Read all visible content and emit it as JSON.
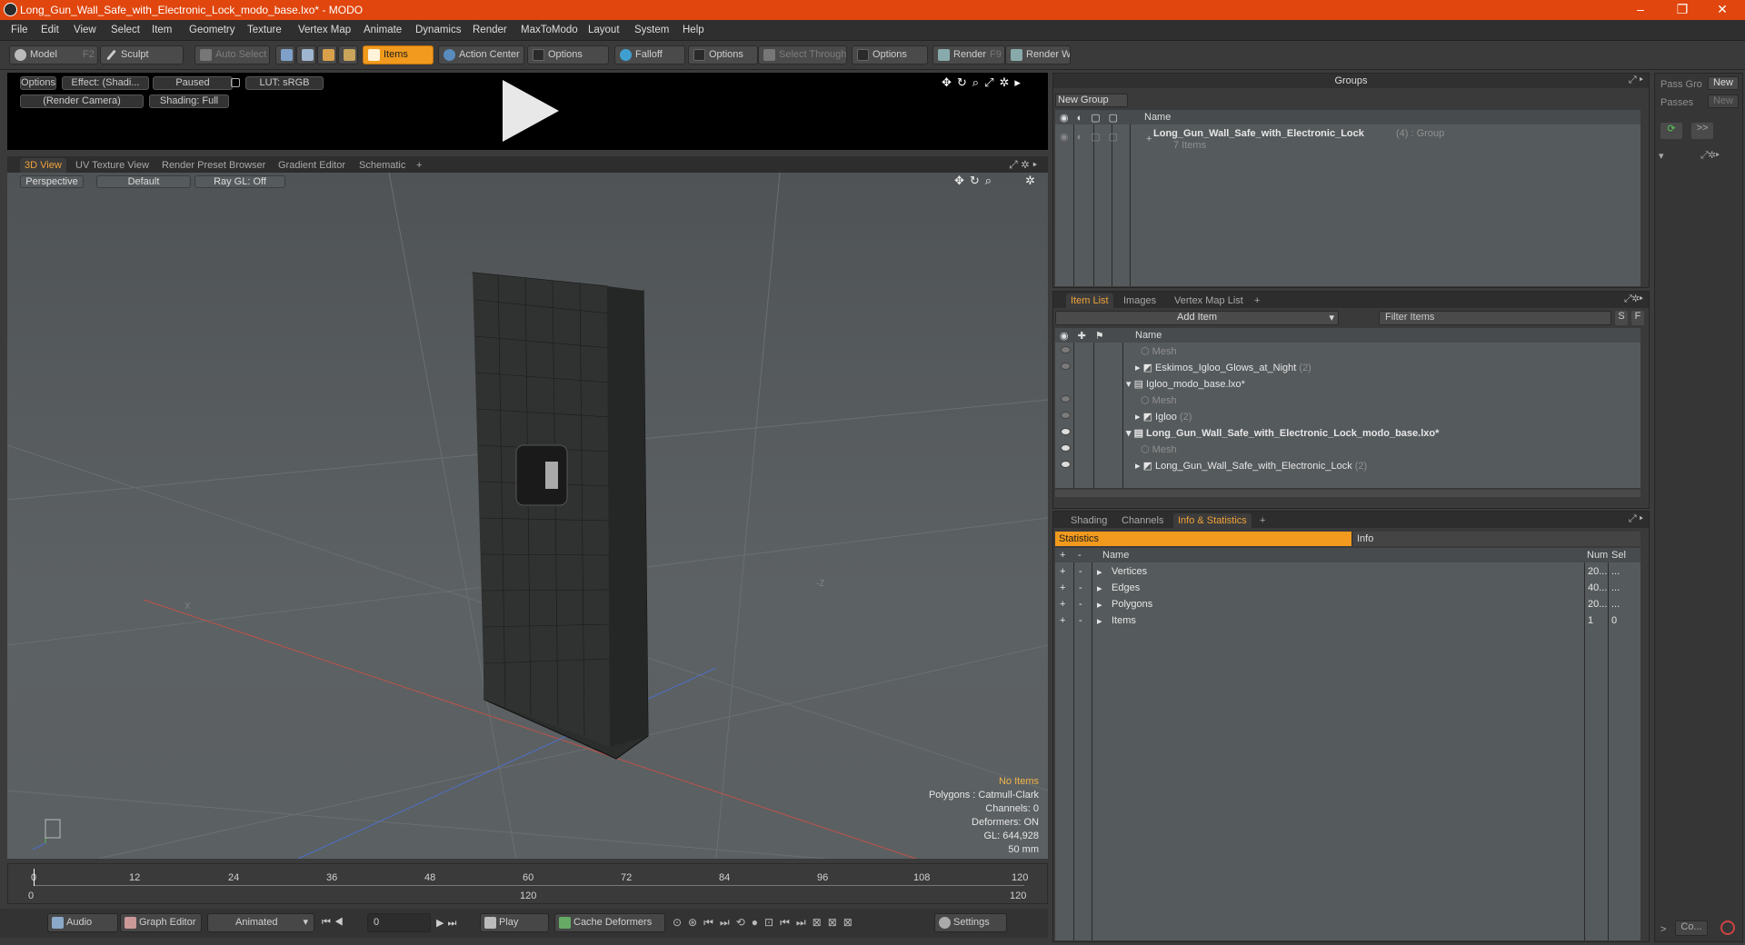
{
  "window": {
    "title": "Long_Gun_Wall_Safe_with_Electronic_Lock_modo_base.lxo* - MODO",
    "minimize": "–",
    "maximize": "❐",
    "close": "✕"
  },
  "menu": [
    "File",
    "Edit",
    "View",
    "Select",
    "Item",
    "Geometry",
    "Texture",
    "Vertex Map",
    "Animate",
    "Dynamics",
    "Render",
    "MaxToModo",
    "Layout",
    "System",
    "Help"
  ],
  "toolbar": {
    "model": "Model",
    "model_key": "F2",
    "sculpt": "Sculpt",
    "auto_select": "Auto Select",
    "items": "Items",
    "action_center": "Action Center",
    "options1": "Options",
    "falloff": "Falloff",
    "options2": "Options",
    "select_through": "Select Through",
    "options3": "Options",
    "render": "Render",
    "render_key": "F9",
    "render_window": "Render Window"
  },
  "preview": {
    "options": "Options",
    "effect": "Effect: (Shadi...",
    "paused": "Paused",
    "lut": "LUT: sRGB",
    "camera": "(Render Camera)",
    "shading": "Shading: Full"
  },
  "viewport_tabs": [
    "3D View",
    "UV Texture View",
    "Render Preset Browser",
    "Gradient Editor",
    "Schematic",
    "+"
  ],
  "viewport": {
    "perspective": "Perspective",
    "default": "Default",
    "raygl": "Ray GL: Off",
    "axis_x": "X",
    "axis_z": "-Z",
    "stats": {
      "no_items": "No Items",
      "polygons": "Polygons : Catmull-Clark",
      "channels": "Channels: 0",
      "deformers": "Deformers: ON",
      "gl": "GL: 644,928",
      "lens": "50 mm"
    }
  },
  "timeline": {
    "ticks": [
      "0",
      "12",
      "24",
      "36",
      "48",
      "60",
      "72",
      "84",
      "96",
      "108",
      "120"
    ],
    "start": "0",
    "mid": "120",
    "end": "120"
  },
  "bottom": {
    "audio": "Audio",
    "graph_editor": "Graph Editor",
    "animated": "Animated",
    "frame": "0",
    "play": "Play",
    "cache": "Cache Deformers",
    "settings": "Settings"
  },
  "groups": {
    "title": "Groups",
    "new_group": "New Group",
    "col_name": "Name",
    "item_name": "Long_Gun_Wall_Safe_with_Electronic_Lock",
    "item_count": "(4) : Group",
    "item_sub": "7 Items"
  },
  "pass": {
    "pass_gro": "Pass Gro",
    "new1": "New",
    "passes": "Passes",
    "new2": "New",
    "more": ">>",
    "co": "Co..."
  },
  "itemlist": {
    "tabs": [
      "Item List",
      "Images",
      "Vertex Map List",
      "+"
    ],
    "add_item": "Add Item",
    "filter": "Filter Items",
    "s": "S",
    "f": "F",
    "col_name": "Name",
    "rows": [
      {
        "name": "Mesh",
        "indent": 0,
        "dim": true,
        "eye": true
      },
      {
        "name": "Eskimos_Igloo_Glows_at_Night",
        "count": "(2)",
        "indent": 0,
        "dim": false,
        "eye": true
      },
      {
        "name": "Igloo_modo_base.lxo*",
        "indent": -1,
        "dim": false,
        "eye": false
      },
      {
        "name": "Mesh",
        "indent": 0,
        "dim": true,
        "eye": true
      },
      {
        "name": "Igloo",
        "count": "(2)",
        "indent": 0,
        "dim": false,
        "eye": true
      },
      {
        "name": "Long_Gun_Wall_Safe_with_Electronic_Lock_modo_base.lxo*",
        "indent": -1,
        "dim": false,
        "eye": true,
        "bold": true
      },
      {
        "name": "Mesh",
        "indent": 0,
        "dim": true,
        "eye": true
      },
      {
        "name": "Long_Gun_Wall_Safe_with_Electronic_Lock",
        "count": "(2)",
        "indent": 0,
        "dim": false,
        "eye": true
      }
    ]
  },
  "info": {
    "tabs": [
      "Shading",
      "Channels",
      "Info & Statistics",
      "+"
    ],
    "statistics": "Statistics",
    "info": "Info",
    "col_name": "Name",
    "col_num": "Num",
    "col_sel": "Sel",
    "rows": [
      {
        "name": "Vertices",
        "num": "20...",
        "sel": "..."
      },
      {
        "name": "Edges",
        "num": "40...",
        "sel": "..."
      },
      {
        "name": "Polygons",
        "num": "20...",
        "sel": "..."
      },
      {
        "name": "Items",
        "num": "1",
        "sel": "0"
      }
    ]
  }
}
